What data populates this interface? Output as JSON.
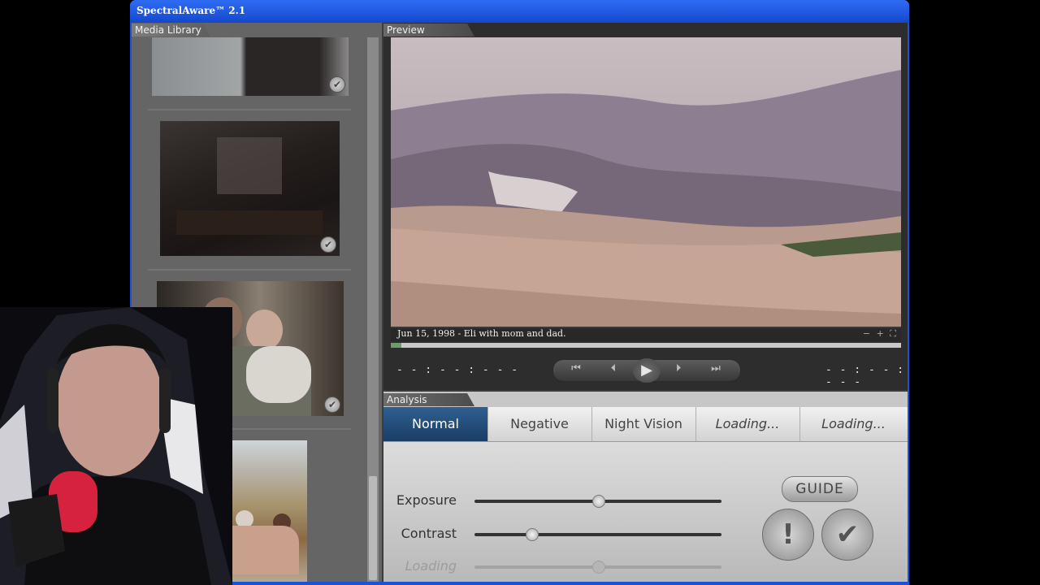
{
  "window": {
    "title": "SpectralAware™ 2.1"
  },
  "media_library": {
    "label": "Media Library"
  },
  "preview": {
    "label": "Preview",
    "caption": "Jun 15, 1998 - Eli with mom and dad.",
    "mini_controls": "− + ⛶",
    "time_current": "- - : - - : - - -",
    "time_total": "- - : - - : - - -",
    "progress_percent": 2
  },
  "transport": {
    "first": "⏮",
    "prev": "⏴",
    "play": "▶",
    "next": "⏵",
    "last": "⏭"
  },
  "analysis": {
    "label": "Analysis",
    "modes": [
      {
        "label": "Normal"
      },
      {
        "label": "Negative"
      },
      {
        "label": "Night Vision"
      },
      {
        "label": "Loading..."
      },
      {
        "label": "Loading..."
      }
    ],
    "sliders": [
      {
        "label": "Exposure",
        "value": 0.5
      },
      {
        "label": "Contrast",
        "value": 0.23
      },
      {
        "label": "Loading",
        "value": 0.5
      }
    ],
    "guide_label": "GUIDE",
    "alert_label": "!",
    "confirm_label": "✔"
  },
  "colors": {
    "title_bar": "#1a52d8",
    "active_mode": "#1a3e66"
  }
}
